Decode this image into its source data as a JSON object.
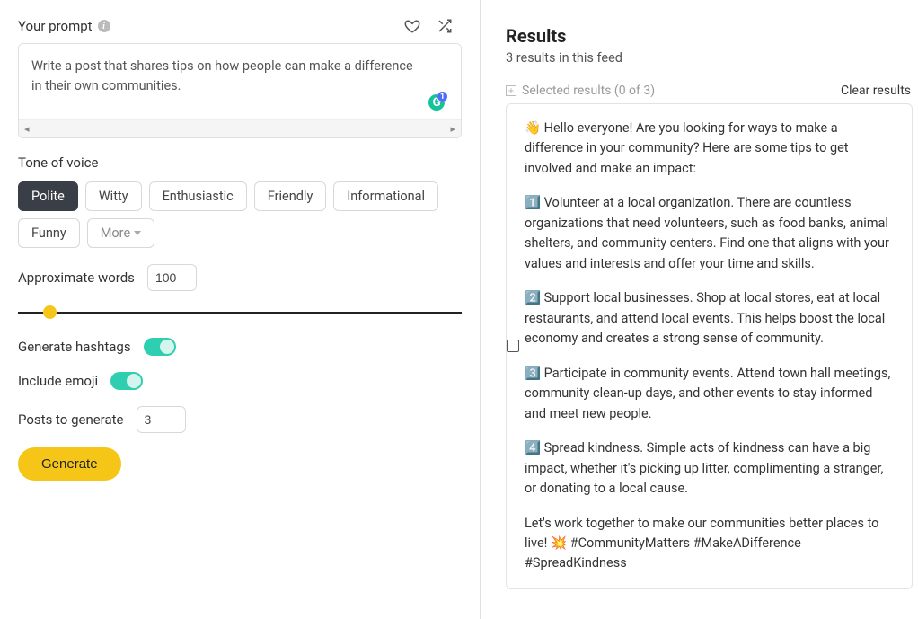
{
  "prompt": {
    "label": "Your prompt",
    "value": "Write a post that shares tips on how people can make a difference in their own communities.",
    "grammarly_count": "1"
  },
  "tone": {
    "label": "Tone of voice",
    "options": [
      "Polite",
      "Witty",
      "Enthusiastic",
      "Friendly",
      "Informational",
      "Funny"
    ],
    "more_label": "More",
    "selected": "Polite"
  },
  "approx_words": {
    "label": "Approximate words",
    "value": "100"
  },
  "hashtags": {
    "label": "Generate hashtags",
    "on": true
  },
  "emoji": {
    "label": "Include emoji",
    "on": true
  },
  "posts_to_generate": {
    "label": "Posts to generate",
    "value": "3"
  },
  "generate_button": "Generate",
  "results": {
    "title": "Results",
    "subtitle": "3 results in this feed",
    "selected_label": "Selected results (0 of 3)",
    "clear_label": "Clear results",
    "items": [
      {
        "paragraphs": [
          "👋 Hello everyone! Are you looking for ways to make a difference in your community? Here are some tips to get involved and make an impact:",
          "1️⃣ Volunteer at a local organization. There are countless organizations that need volunteers, such as food banks, animal shelters, and community centers. Find one that aligns with your values and interests and offer your time and skills.",
          "2️⃣ Support local businesses. Shop at local stores, eat at local restaurants, and attend local events. This helps boost the local economy and creates a strong sense of community.",
          "3️⃣ Participate in community events. Attend town hall meetings, community clean-up days, and other events to stay informed and meet new people.",
          "4️⃣ Spread kindness. Simple acts of kindness can have a big impact, whether it's picking up litter, complimenting a stranger, or donating to a local cause.",
          "Let's work together to make our communities better places to live! 💥 #CommunityMatters #MakeADifference #SpreadKindness"
        ]
      }
    ]
  }
}
